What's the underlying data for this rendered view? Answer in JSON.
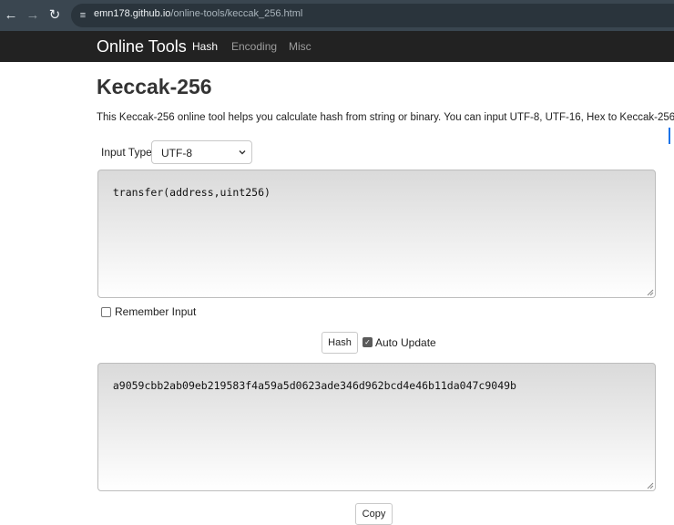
{
  "browser": {
    "url_host": "emn178.github.io",
    "url_path": "/online-tools/keccak_256.html",
    "icons": [
      "back-arrow-icon",
      "forward-arrow-icon",
      "reload-icon",
      "site-settings-icon"
    ]
  },
  "navbar": {
    "brand": "Online Tools",
    "links": [
      "Hash",
      "Encoding",
      "Misc"
    ],
    "active": "Hash"
  },
  "page": {
    "title": "Keccak-256",
    "description": "This Keccak-256 online tool helps you calculate hash from string or binary. You can input UTF-8, UTF-16, Hex to Keccak-256."
  },
  "form": {
    "input_type_label": "Input Type",
    "input_type_value": "UTF-8",
    "input_text": "transfer(address,uint256)",
    "remember_input_label": "Remember Input",
    "remember_input_checked": false,
    "hash_button_label": "Hash",
    "auto_update_label": "Auto Update",
    "auto_update_checked": true,
    "output_text": "a9059cbb2ab09eb219583f4a59a5d0623ade346d962bcd4e46b11da047c9049b",
    "copy_button_label": "Copy"
  },
  "colors": {
    "navbar_bg": "#222222",
    "chrome_bg": "#3a4650",
    "accent": "#1a73e8"
  }
}
